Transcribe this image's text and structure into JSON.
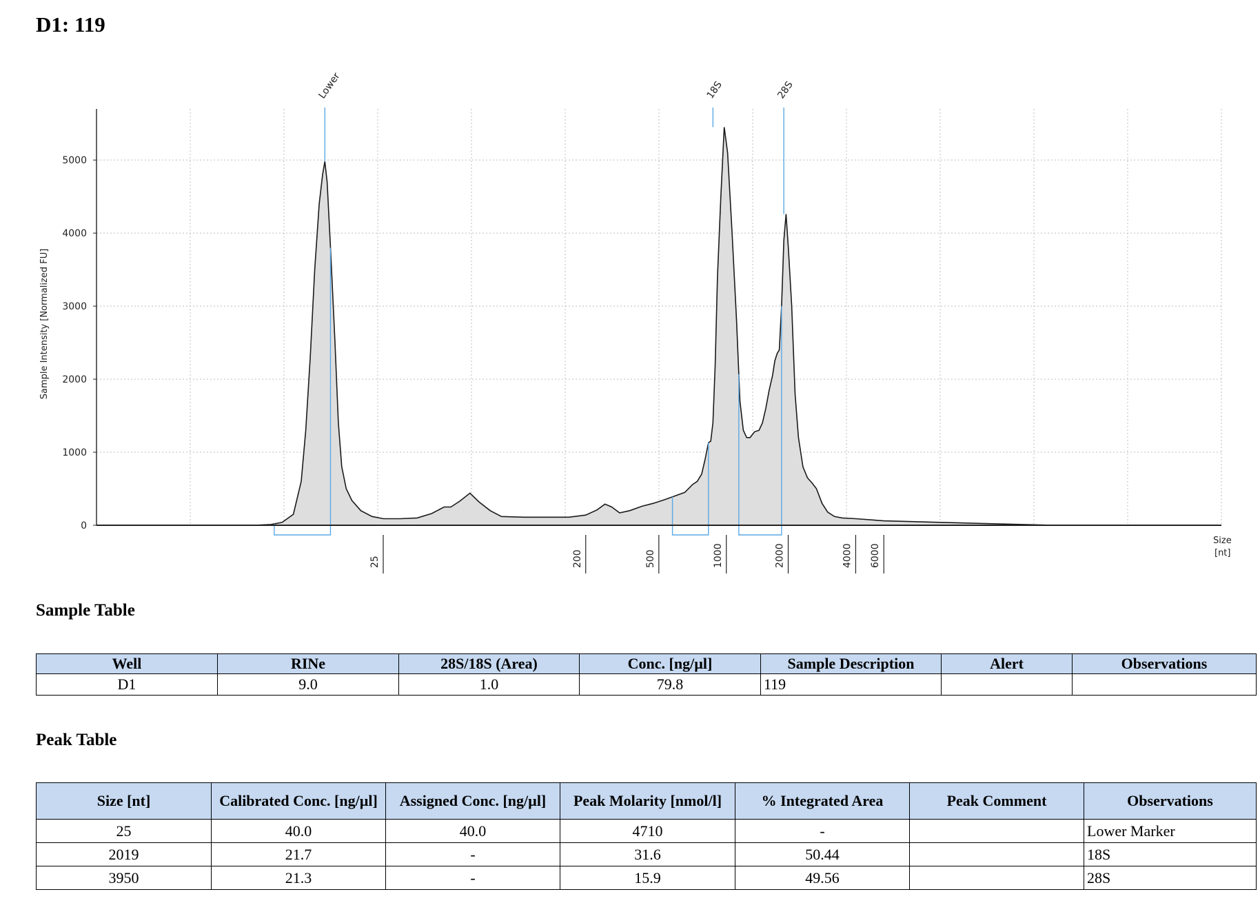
{
  "header": {
    "title": "D1: 119"
  },
  "chart_data": {
    "type": "line",
    "ylabel": "Sample Intensity [Normalized FU]",
    "xlabel": "Size\n[nt]",
    "xlabel_lines": [
      "Size",
      "[nt]"
    ],
    "ylim": [
      0,
      5700
    ],
    "yticks": [
      0,
      1000,
      2000,
      3000,
      4000,
      5000
    ],
    "xticks": [
      {
        "label": "25",
        "pos": 25
      },
      {
        "label": "200",
        "pos": 43
      },
      {
        "label": "500",
        "pos": 49.5
      },
      {
        "label": "1000",
        "pos": 55.5
      },
      {
        "label": "2000",
        "pos": 61
      },
      {
        "label": "4000",
        "pos": 67
      },
      {
        "label": "6000",
        "pos": 69.5
      }
    ],
    "xlim": [
      0,
      100
    ],
    "grid": true,
    "markers": [
      {
        "label": "Lower",
        "pos": 20.3,
        "y": 4980
      },
      {
        "label": "18S",
        "pos": 54.8,
        "y": 5450
      },
      {
        "label": "28S",
        "pos": 61.1,
        "y": 4260
      }
    ],
    "peak_regions": [
      {
        "start": 15.8,
        "end": 20.8
      },
      {
        "start": 51.2,
        "end": 54.4
      },
      {
        "start": 57.1,
        "end": 60.9
      }
    ],
    "series": [
      {
        "x": [
          0,
          8,
          14,
          15.5,
          16.5,
          17.5,
          18.2,
          18.6,
          19.0,
          19.4,
          19.8,
          20.1,
          20.3,
          20.5,
          20.8,
          21.2,
          21.5,
          21.8,
          22.2,
          22.7,
          23.5,
          24.5,
          25.5,
          27,
          28.5,
          29.8,
          30.9,
          31.5,
          32.3,
          33.2,
          34,
          35,
          36,
          38,
          40,
          42,
          43.5,
          44.5,
          45.2,
          45.8,
          46.5,
          47.4,
          48.5,
          49.5,
          50.5,
          51.4,
          52.3,
          53.0,
          53.4,
          53.8,
          54.1,
          54.4,
          54.6,
          54.8,
          55.0,
          55.2,
          55.5,
          55.8,
          56.1,
          56.5,
          56.9,
          57.2,
          57.5,
          57.8,
          58.1,
          58.5,
          58.9,
          59.2,
          59.5,
          59.8,
          60.1,
          60.3,
          60.5,
          60.7,
          60.9,
          61.1,
          61.3,
          61.5,
          61.8,
          62.1,
          62.4,
          62.8,
          63.2,
          63.6,
          64.0,
          64.5,
          65.0,
          65.6,
          66.3,
          67.5,
          70,
          75,
          80,
          85,
          90,
          95,
          100
        ],
        "values": [
          0,
          0,
          0,
          10,
          40,
          150,
          600,
          1300,
          2300,
          3500,
          4400,
          4800,
          4980,
          4700,
          3800,
          2500,
          1400,
          800,
          500,
          340,
          200,
          120,
          90,
          90,
          100,
          160,
          250,
          250,
          330,
          440,
          320,
          200,
          120,
          110,
          110,
          110,
          140,
          210,
          290,
          250,
          170,
          200,
          260,
          300,
          350,
          400,
          450,
          560,
          600,
          700,
          900,
          1130,
          1150,
          1400,
          2200,
          3400,
          4500,
          5450,
          5100,
          4000,
          2800,
          1700,
          1300,
          1200,
          1200,
          1280,
          1300,
          1400,
          1600,
          1850,
          2050,
          2250,
          2350,
          2400,
          3000,
          3900,
          4260,
          3800,
          3000,
          1800,
          1200,
          800,
          650,
          580,
          500,
          300,
          180,
          120,
          100,
          90,
          60,
          40,
          20,
          0,
          0,
          0,
          0
        ]
      }
    ]
  },
  "sample_table": {
    "title": "Sample Table",
    "headers": [
      "Well",
      "RINe",
      "28S/18S (Area)",
      "Conc. [ng/µl]",
      "Sample Description",
      "Alert",
      "Observations"
    ],
    "rows": [
      [
        "D1",
        "9.0",
        "1.0",
        "79.8",
        "119",
        "",
        ""
      ]
    ]
  },
  "peak_table": {
    "title": "Peak Table",
    "headers": [
      "Size [nt]",
      "Calibrated Conc. [ng/µl]",
      "Assigned Conc. [ng/µl]",
      "Peak Molarity [nmol/l]",
      "% Integrated Area",
      "Peak Comment",
      "Observations"
    ],
    "rows": [
      [
        "25",
        "40.0",
        "40.0",
        "4710",
        "-",
        "",
        "Lower Marker"
      ],
      [
        "2019",
        "21.7",
        "-",
        "31.6",
        "50.44",
        "",
        "18S"
      ],
      [
        "3950",
        "21.3",
        "-",
        "15.9",
        "49.56",
        "",
        "28S"
      ]
    ]
  },
  "colors": {
    "fill": "#dedede",
    "line": "#1a1a1a",
    "marker": "#5aa9e6",
    "grid": "#bdbdbd",
    "header_bg": "#c6d9f1"
  }
}
